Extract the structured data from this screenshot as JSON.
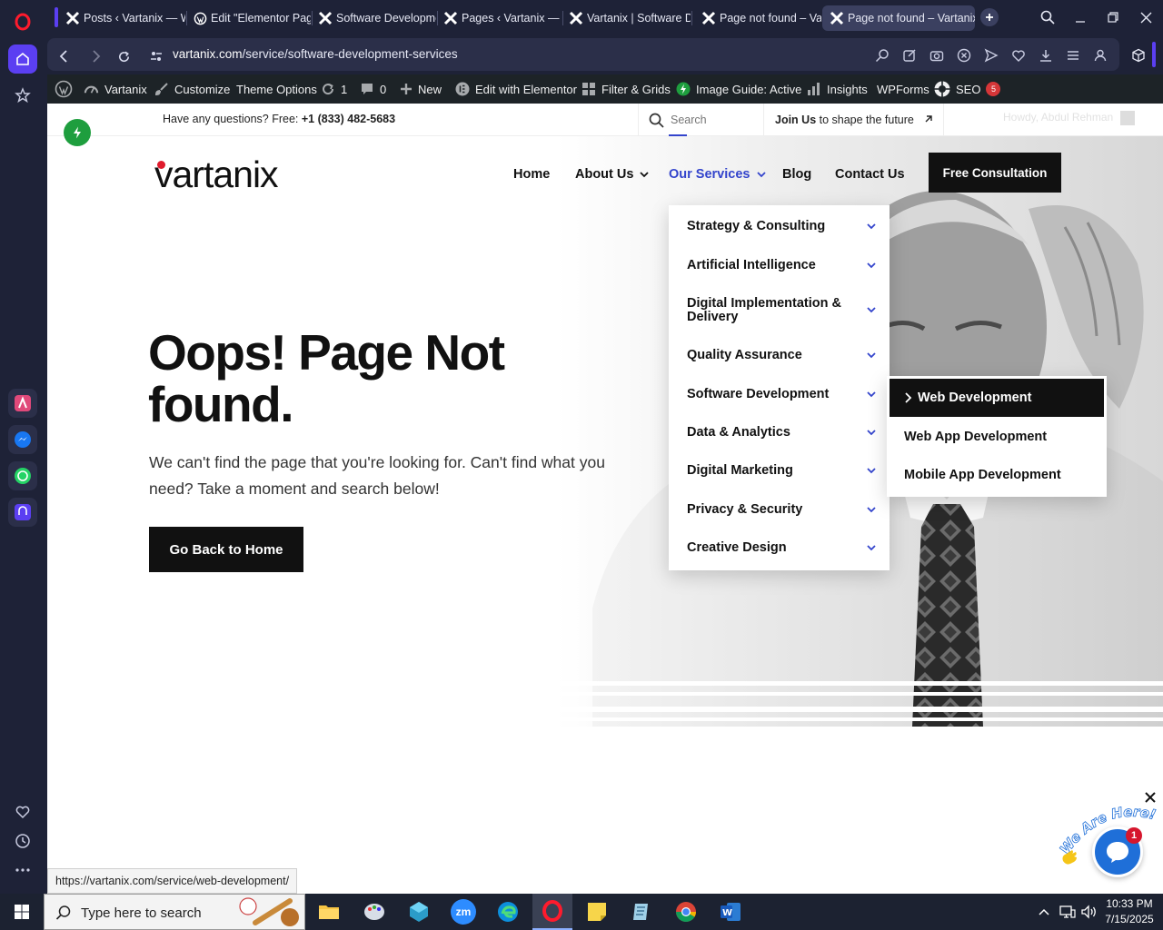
{
  "tabs": [
    {
      "title": "Posts ‹ Vartanix — W",
      "icon": "vartanix-x-icon"
    },
    {
      "title": "Edit \"Elementor Page",
      "icon": "wordpress-icon"
    },
    {
      "title": "Software Developme",
      "icon": "vartanix-x-icon"
    },
    {
      "title": "Pages ‹ Vartanix — W",
      "icon": "vartanix-x-icon"
    },
    {
      "title": "Vartanix | Software D",
      "icon": "vartanix-x-icon"
    },
    {
      "title": "Page not found – Va",
      "icon": "vartanix-x-icon"
    },
    {
      "title": "Page not found – Vartanix",
      "icon": "vartanix-x-icon",
      "active": true
    }
  ],
  "address": {
    "host": "vartanix.com",
    "path": "/service/software-development-services"
  },
  "wpbar": {
    "site": "Vartanix",
    "customize": "Customize",
    "theme_options": "Theme Options",
    "updates_count": "1",
    "comments_count": "0",
    "new": "New",
    "edit_elementor": "Edit with Elementor",
    "filter_grids": "Filter & Grids",
    "image_guide": "Image Guide: Active",
    "insights": "Insights",
    "wpforms": "WPForms",
    "seo": "SEO",
    "seo_badge": "5"
  },
  "topstrip": {
    "question": "Have any questions? Free: ",
    "phone": "+1 (833) 482-5683",
    "search_placeholder": "Search",
    "join_strong": "Join Us",
    "join_rest": " to shape the future",
    "howdy": "Howdy, Abdul Rehman"
  },
  "logo": {
    "text": "vartanix"
  },
  "nav": {
    "home": "Home",
    "about": "About Us",
    "services": "Our Services",
    "blog": "Blog",
    "contact": "Contact Us",
    "cta": "Free Consultation"
  },
  "dropdown": [
    "Strategy & Consulting",
    "Artificial Intelligence",
    "Digital Implementation & Delivery",
    "Quality Assurance",
    "Software Development",
    "Data & Analytics",
    "Digital Marketing",
    "Privacy & Security",
    "Creative Design"
  ],
  "submenu": [
    "Web Development",
    "Web App Development",
    "Mobile App Development"
  ],
  "hero": {
    "title_line1": "Oops! Page Not",
    "title_line2": "found.",
    "desc": "We can't find the page that you're looking for. Can't find what you need? Take a moment and search below!",
    "button": "Go Back to Home"
  },
  "chat": {
    "badge": "1",
    "label": "We Are Here!"
  },
  "status_url": "https://vartanix.com/service/web-development/",
  "taskbar": {
    "search_placeholder": "Type here to search",
    "time": "10:33 PM",
    "date": "7/15/2025"
  },
  "colors": {
    "accent": "#3344cc",
    "dark": "#111111",
    "browser_bg": "#1e2237",
    "wpbar": "#1d2327"
  }
}
